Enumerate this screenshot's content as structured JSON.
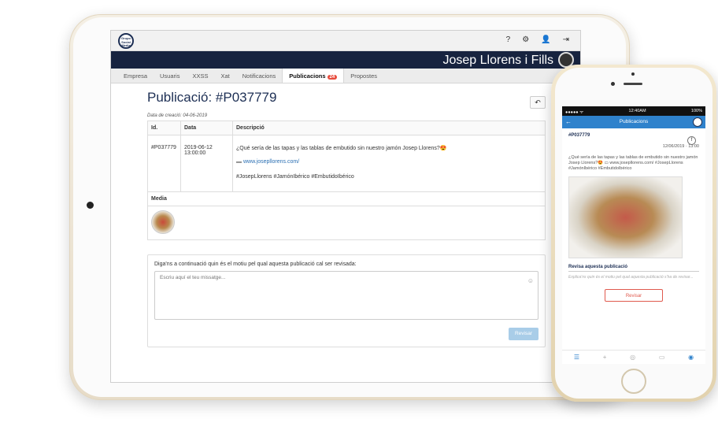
{
  "app": {
    "logo_text": "Grupo Social Media"
  },
  "topbar": {
    "icons": [
      "?",
      "⚙",
      "👤",
      "⇥"
    ]
  },
  "user": {
    "name": "Josep Llorens i Fills"
  },
  "tabs": [
    {
      "label": "Empresa"
    },
    {
      "label": "Usuaris"
    },
    {
      "label": "XXSS"
    },
    {
      "label": "Xat"
    },
    {
      "label": "Notificacions"
    },
    {
      "label": "Publicacions",
      "badge": "24",
      "active": true
    },
    {
      "label": "Propostes"
    }
  ],
  "page": {
    "title": "Publicació: #P037779",
    "back_icon": "↶",
    "created": "Data de creació: 04-06-2019"
  },
  "table": {
    "headers": [
      "Id.",
      "Data",
      "Descripció"
    ],
    "row": {
      "id": "#P037779",
      "date": "2019-06-12 13:00:00",
      "description": "¿Qué sería de las tapas y las tablas de embutido sin nuestro jamón Josep Llorens?😍",
      "link": "www.josepllorens.com/",
      "hashtags": "#JosepLlorens #JamónIbérico #EmbutidoIbérico"
    },
    "media_label": "Media"
  },
  "review": {
    "label": "Diga'ns a continuació quin és el motiu pel qual aquesta publicació cal ser revisada:",
    "placeholder": "Escriu aquí el teu missatge...",
    "button": "Revisar"
  },
  "phone": {
    "status_left": "●●●●● ᯤ",
    "status_time": "12:40AM",
    "status_right": "100%",
    "header_title": "Publicacions",
    "back_icon": "←",
    "pub_id": "#P037779",
    "fb_icon": "f",
    "date": "12/06/2019 · 13:00",
    "description": "¿Qué sería de las tapas y las tablas de embutido sin nuestro jamón Josep Llorens?😍 ▭ www.josepllorens.com/ #JosepLlorens #JamónIbérico #EmbutidoIbérico",
    "review_title": "Revisa aquesta publicació",
    "review_placeholder": "Explica’ns quin és el motiu pel qual aquesta publicació s’ha de revisar...",
    "review_button": "Revisar",
    "tabbar": [
      "☰",
      "+",
      "◎",
      "▭",
      "◉"
    ]
  },
  "colors": {
    "navy": "#17233f",
    "accent_blue": "#2f82cc",
    "badge_red": "#e84c3d"
  }
}
